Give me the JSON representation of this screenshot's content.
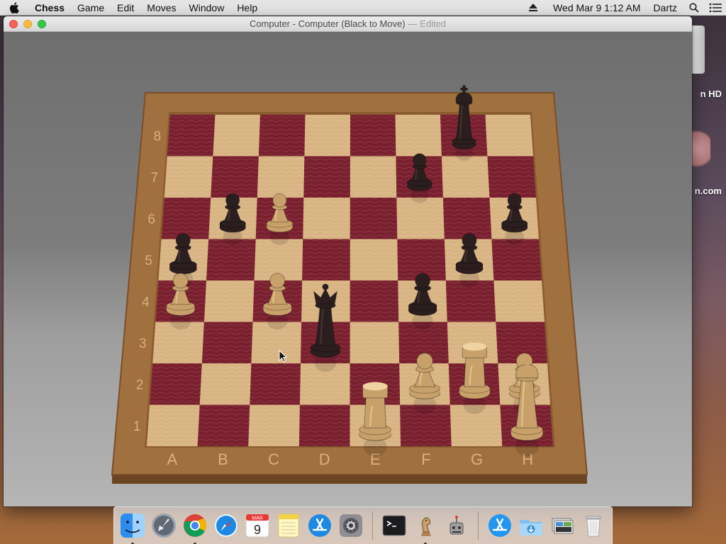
{
  "menubar": {
    "app_name": "Chess",
    "menus": [
      "Game",
      "Edit",
      "Moves",
      "Window",
      "Help"
    ],
    "datetime": "Wed Mar 9  1:12 AM",
    "user": "Dartz"
  },
  "window": {
    "title": "Computer - Computer   (Black to Move)",
    "edited": "— Edited"
  },
  "desktop": {
    "items": [
      "n HD",
      "n.com"
    ]
  },
  "board": {
    "files": [
      "A",
      "B",
      "C",
      "D",
      "E",
      "F",
      "G",
      "H"
    ],
    "ranks": [
      "1",
      "2",
      "3",
      "4",
      "5",
      "6",
      "7",
      "8"
    ],
    "colors": {
      "light": "#d9b483",
      "dark": "#7a1f2e",
      "frame": "#a0703e",
      "white_piece": "#c8a06a",
      "black_piece": "#2a1e1e"
    },
    "pieces": [
      {
        "square": "g8",
        "color": "black",
        "type": "king"
      },
      {
        "square": "f7",
        "color": "black",
        "type": "pawn"
      },
      {
        "square": "b6",
        "color": "black",
        "type": "pawn"
      },
      {
        "square": "h6",
        "color": "black",
        "type": "pawn"
      },
      {
        "square": "a5",
        "color": "black",
        "type": "pawn"
      },
      {
        "square": "g5",
        "color": "black",
        "type": "pawn"
      },
      {
        "square": "f4",
        "color": "black",
        "type": "pawn"
      },
      {
        "square": "d3",
        "color": "black",
        "type": "queen"
      },
      {
        "square": "c6",
        "color": "white",
        "type": "pawn"
      },
      {
        "square": "a4",
        "color": "white",
        "type": "pawn"
      },
      {
        "square": "c4",
        "color": "white",
        "type": "pawn"
      },
      {
        "square": "f2",
        "color": "white",
        "type": "pawn"
      },
      {
        "square": "g2",
        "color": "white",
        "type": "rook"
      },
      {
        "square": "h2",
        "color": "white",
        "type": "pawn"
      },
      {
        "square": "e1",
        "color": "white",
        "type": "rook"
      },
      {
        "square": "h1",
        "color": "white",
        "type": "king"
      }
    ]
  },
  "dock": {
    "calendar": {
      "month": "MAR",
      "day": "9"
    },
    "items": [
      "finder-icon",
      "launchpad-icon",
      "chrome-icon",
      "safari-icon",
      "calendar-icon",
      "notes-icon",
      "app-store-icon",
      "system-preferences-icon",
      "terminal-icon",
      "chess-icon",
      "automator-icon",
      "app-store-folder-icon",
      "downloads-folder-icon",
      "screenshot-stack-icon",
      "trash-icon"
    ],
    "running": [
      "finder-icon",
      "chrome-icon",
      "chess-icon"
    ]
  }
}
